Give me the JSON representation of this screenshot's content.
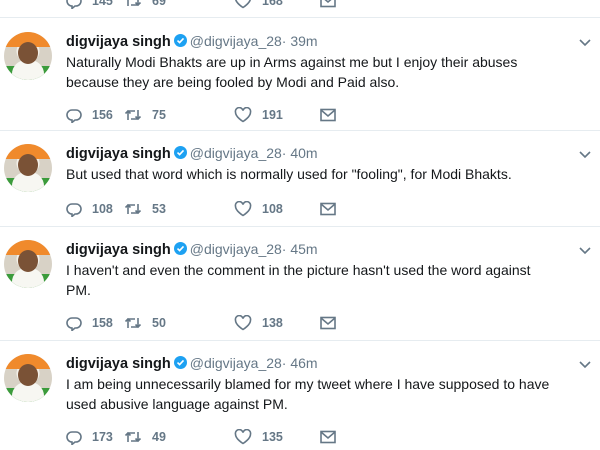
{
  "partial_top": {
    "replies": "145",
    "retweets": "69",
    "likes": "168"
  },
  "tweets": [
    {
      "name": "digvijaya singh",
      "handle": "@digvijaya_28",
      "time": "· 39m",
      "text_lines": [
        "Naturally Modi Bhakts are up in Arms against me but I enjoy their abuses",
        "because they are being fooled by Modi and Paid also."
      ],
      "replies": "156",
      "retweets": "75",
      "likes": "191"
    },
    {
      "name": "digvijaya singh",
      "handle": "@digvijaya_28",
      "time": "· 40m",
      "text_lines": [
        "But used that word which is normally used for \"fooling\", for Modi Bhakts."
      ],
      "replies": "108",
      "retweets": "53",
      "likes": "108"
    },
    {
      "name": "digvijaya singh",
      "handle": "@digvijaya_28",
      "time": "· 45m",
      "text_lines": [
        "I haven't and even the comment in the picture hasn't used the word against",
        "PM."
      ],
      "replies": "158",
      "retweets": "50",
      "likes": "138"
    },
    {
      "name": "digvijaya singh",
      "handle": "@digvijaya_28",
      "time": "· 46m",
      "text_lines": [
        "I am being unnecessarily blamed for my tweet where I have supposed to have",
        "used abusive language against PM."
      ],
      "replies": "173",
      "retweets": "49",
      "likes": "135"
    }
  ],
  "icons": {
    "reply": "reply-icon",
    "retweet": "retweet-icon",
    "like": "heart-icon",
    "dm": "envelope-icon",
    "verified": "verified-badge-icon",
    "caret": "chevron-down-icon"
  },
  "colors": {
    "muted": "#657786",
    "verified": "#1da1f2",
    "divider": "#e6ecf0"
  }
}
